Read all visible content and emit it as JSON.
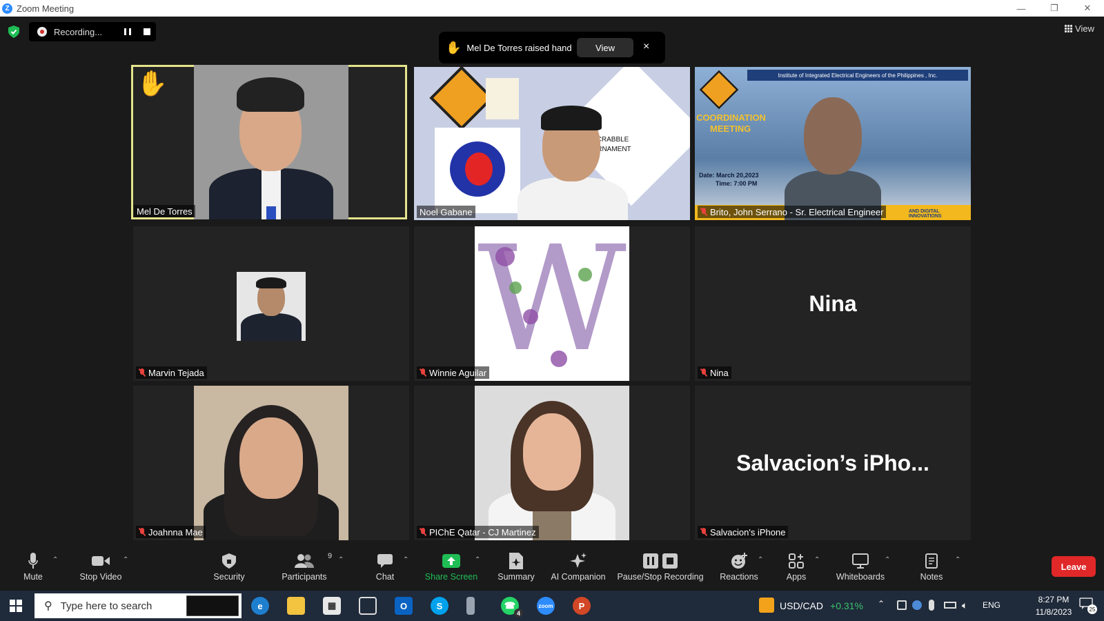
{
  "window": {
    "title": "Zoom Meeting",
    "minimize": "—",
    "restore": "❐",
    "close": "✕"
  },
  "recording": {
    "status": "Recording..."
  },
  "top_view_label": "View",
  "hand_notification": {
    "text": "Mel De Torres raised hand",
    "view_button": "View",
    "close": "×"
  },
  "participants": [
    {
      "name": "Mel De Torres",
      "muted": false,
      "hand_raised": true,
      "active_speaker": true
    },
    {
      "name": "Noel Gabane",
      "muted": false
    },
    {
      "name": "Brito, John Serrano - Sr. Electrical Engineer",
      "muted": true
    },
    {
      "name": "Marvin Tejada",
      "muted": true
    },
    {
      "name": "Winnie Aguilar",
      "muted": true
    },
    {
      "name": "Nina",
      "muted": true,
      "display_text": "Nina"
    },
    {
      "name": "Joahnna Mae",
      "muted": true
    },
    {
      "name": "PIChE Qatar - CJ Martinez",
      "muted": true
    },
    {
      "name": "Salvacion's iPhone",
      "muted": true,
      "display_text": "Salvacion’s  iPho..."
    }
  ],
  "tile_content": {
    "noel_bg_text_1": "SCRABBLE",
    "noel_bg_text_2": "URNAMENT",
    "brito_banner": "Institute of Integrated Electrical Engineers of the Philippines , Inc.",
    "brito_title_1": "COORDINATION",
    "brito_title_2": "MEETING",
    "brito_date": "Date: March 20,2023",
    "brito_time": "Time: 7:00 PM",
    "brito_footer": "AND DIGITAL INNOVATIONS",
    "winnie_letter": "W"
  },
  "toolbar": {
    "mute": "Mute",
    "stop_video": "Stop Video",
    "security": "Security",
    "participants": "Participants",
    "participant_count": "9",
    "chat": "Chat",
    "share_screen": "Share Screen",
    "summary": "Summary",
    "ai_companion": "AI Companion",
    "pause_stop_recording": "Pause/Stop Recording",
    "reactions": "Reactions",
    "apps": "Apps",
    "whiteboards": "Whiteboards",
    "notes": "Notes",
    "leave": "Leave"
  },
  "taskbar": {
    "search_placeholder": "Type here to search",
    "whatsapp_badge": "4",
    "ticker_symbol": "USD/CAD",
    "ticker_change": "+0.31%",
    "language": "ENG",
    "time": "8:27 PM",
    "date": "11/8/2023",
    "notification_count": "25"
  },
  "colors": {
    "active_border": "#e4e48c",
    "share_green": "#1fbd55",
    "leave_red": "#e02828",
    "muted_red": "#e8413c"
  }
}
